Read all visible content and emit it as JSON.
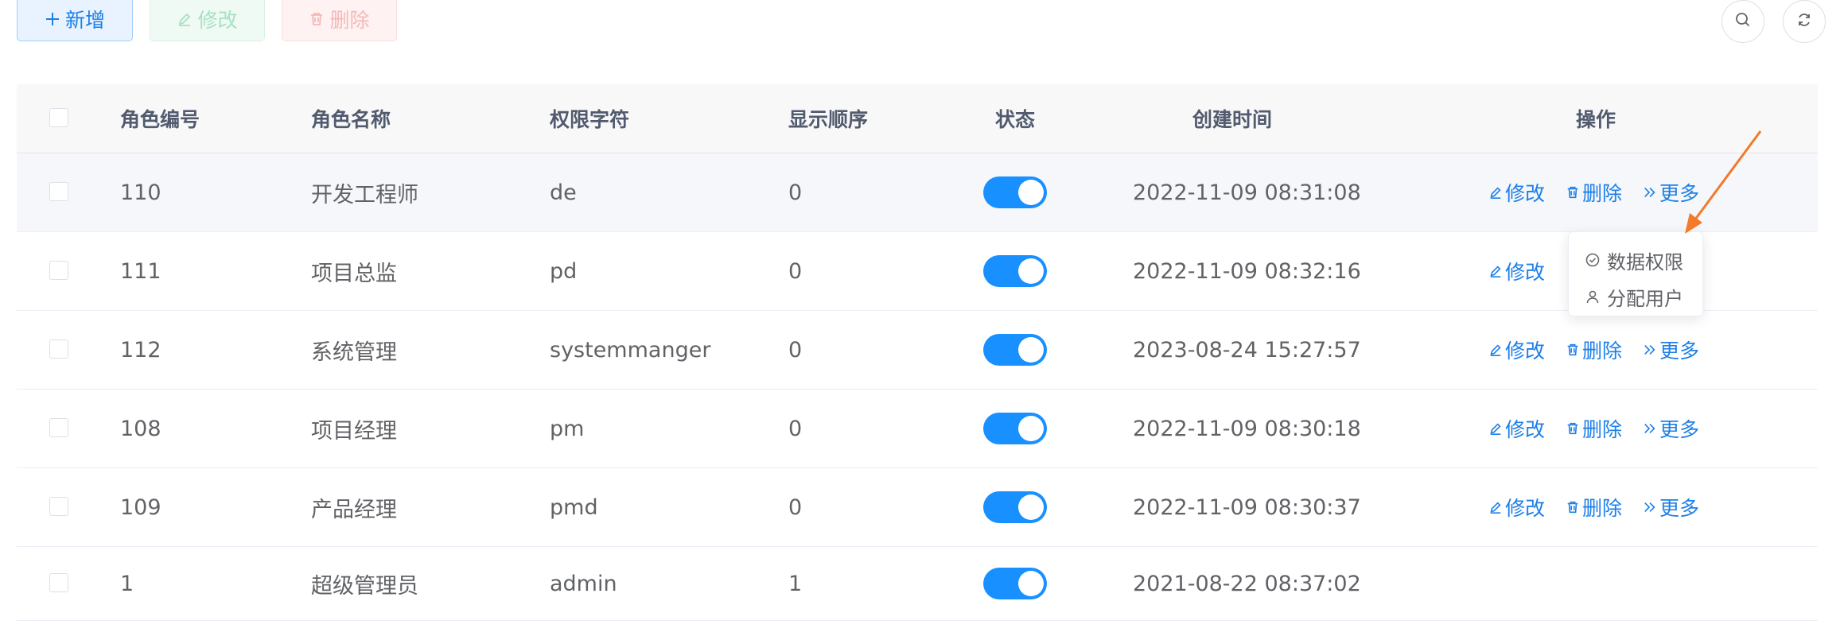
{
  "toolbar": {
    "add_label": "新增",
    "edit_label": "修改",
    "delete_label": "删除"
  },
  "icons": {
    "add": "plus-icon",
    "edit": "edit-icon",
    "delete": "trash-icon",
    "search": "search-icon",
    "refresh": "refresh-icon",
    "more": "double-chevron-icon",
    "data_scope": "check-circle-icon",
    "assign_user": "user-icon"
  },
  "colors": {
    "primary": "#1890ff",
    "link": "#1d7fe8",
    "success_light": "#a8e0c2",
    "danger_light": "#f5b8b8",
    "arrow": "#f27a2a"
  },
  "table": {
    "columns": [
      "角色编号",
      "角色名称",
      "权限字符",
      "显示顺序",
      "状态",
      "创建时间",
      "操作"
    ],
    "rows": [
      {
        "id": "110",
        "name": "开发工程师",
        "key": "de",
        "sort": "0",
        "status": true,
        "time": "2022-11-09 08:31:08"
      },
      {
        "id": "111",
        "name": "项目总监",
        "key": "pd",
        "sort": "0",
        "status": true,
        "time": "2022-11-09 08:32:16"
      },
      {
        "id": "112",
        "name": "系统管理",
        "key": "systemmanger",
        "sort": "0",
        "status": true,
        "time": "2023-08-24 15:27:57"
      },
      {
        "id": "108",
        "name": "项目经理",
        "key": "pm",
        "sort": "0",
        "status": true,
        "time": "2022-11-09 08:30:18"
      },
      {
        "id": "109",
        "name": "产品经理",
        "key": "pmd",
        "sort": "0",
        "status": true,
        "time": "2022-11-09 08:30:37"
      },
      {
        "id": "1",
        "name": "超级管理员",
        "key": "admin",
        "sort": "1",
        "status": true,
        "time": "2021-08-22 08:37:02"
      }
    ],
    "ops": {
      "edit": "修改",
      "delete": "删除",
      "more": "更多"
    }
  },
  "dropdown": {
    "items": [
      "数据权限",
      "分配用户"
    ]
  }
}
